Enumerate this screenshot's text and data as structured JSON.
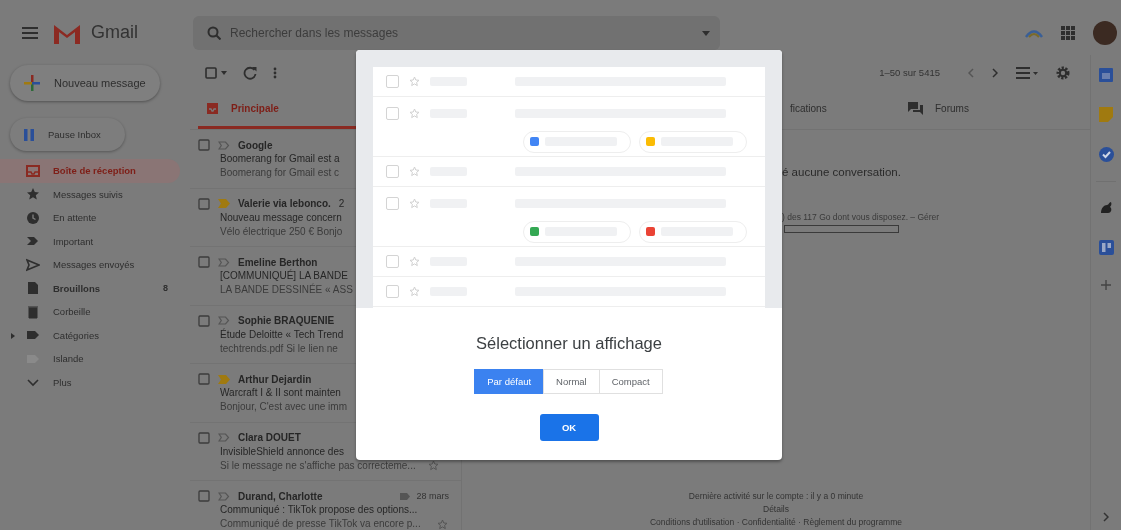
{
  "header": {
    "app_name": "Gmail",
    "search": {
      "placeholder": "Rechercher dans les messages"
    }
  },
  "sidebar": {
    "compose": "Nouveau message",
    "pause_inbox": "Pause Inbox",
    "items": [
      {
        "label": "Boîte de réception",
        "selected": true,
        "bold": true
      },
      {
        "label": "Messages suivis",
        "selected": false,
        "bold": false
      },
      {
        "label": "En attente",
        "selected": false,
        "bold": false
      },
      {
        "label": "Important",
        "selected": false,
        "bold": false
      },
      {
        "label": "Messages envoyés",
        "selected": false,
        "bold": false
      },
      {
        "label": "Brouillons",
        "selected": false,
        "bold": true,
        "count": "8"
      },
      {
        "label": "Corbeille",
        "selected": false,
        "bold": false
      },
      {
        "label": "Catégories",
        "selected": false,
        "bold": false
      },
      {
        "label": "Islande",
        "selected": false,
        "bold": false
      },
      {
        "label": "Plus",
        "selected": false,
        "bold": false
      }
    ]
  },
  "toolbar": {
    "select_all_checked": false,
    "range": "1–50 sur 5415"
  },
  "tabs": [
    {
      "label": "Principale",
      "selected": true
    },
    {
      "label": "fications",
      "selected": false
    },
    {
      "label": "Forums",
      "selected": false
    }
  ],
  "messages": [
    {
      "checked": false,
      "sender": "Google",
      "subject": "Boomerang for Gmail est a",
      "snippet": "Boomerang for Gmail est c",
      "important": false
    },
    {
      "checked": false,
      "sender": "Valerie via lebonco.",
      "count": "2",
      "subject": "Nouveau message concern",
      "snippet": "Vélo électrique 250 € Bonjo",
      "important": true
    },
    {
      "checked": false,
      "sender": "Emeline Berthon",
      "subject": "[COMMUNIQUÉ] LA BANDE",
      "snippet": "LA BANDE DESSINÉE « ASS",
      "important": false
    },
    {
      "checked": false,
      "sender": "Sophie BRAQUENIE",
      "subject": "Étude Deloitte « Tech Trend",
      "snippet": "techtrends.pdf Si le lien ne",
      "important": false
    },
    {
      "checked": false,
      "sender": "Arthur Dejardin",
      "subject": "Warcraft I & II sont mainten",
      "snippet": "Bonjour, C'est avec une imm",
      "important": true
    },
    {
      "checked": false,
      "sender": "Clara DOUET",
      "subject": "InvisibleShield annonce des",
      "snippet": "Si le message ne s'affiche pas correcteme...",
      "important": false
    },
    {
      "checked": false,
      "sender": "Durand, Charlotte",
      "date": "28 mars",
      "subject": "Communiqué : TikTok propose des options...",
      "snippet": "Communiqué de presse TikTok va encore p...",
      "important": false
    }
  ],
  "pane": {
    "empty_message": "é aucune conversation.",
    "storage": ") des 117 Go dont vous disposez. – Gérer"
  },
  "footer": {
    "last_activity": "Dernière activité sur le compte : il y a 0 minute",
    "details": "Détails",
    "terms": "Conditions d'utilisation · Confidentialité · Règlement du programme"
  },
  "dialog": {
    "title": "Sélectionner un affichage",
    "options": [
      {
        "label": "Par défaut",
        "selected": true
      },
      {
        "label": "Normal",
        "selected": false
      },
      {
        "label": "Compact",
        "selected": false
      }
    ],
    "ok": "OK"
  }
}
